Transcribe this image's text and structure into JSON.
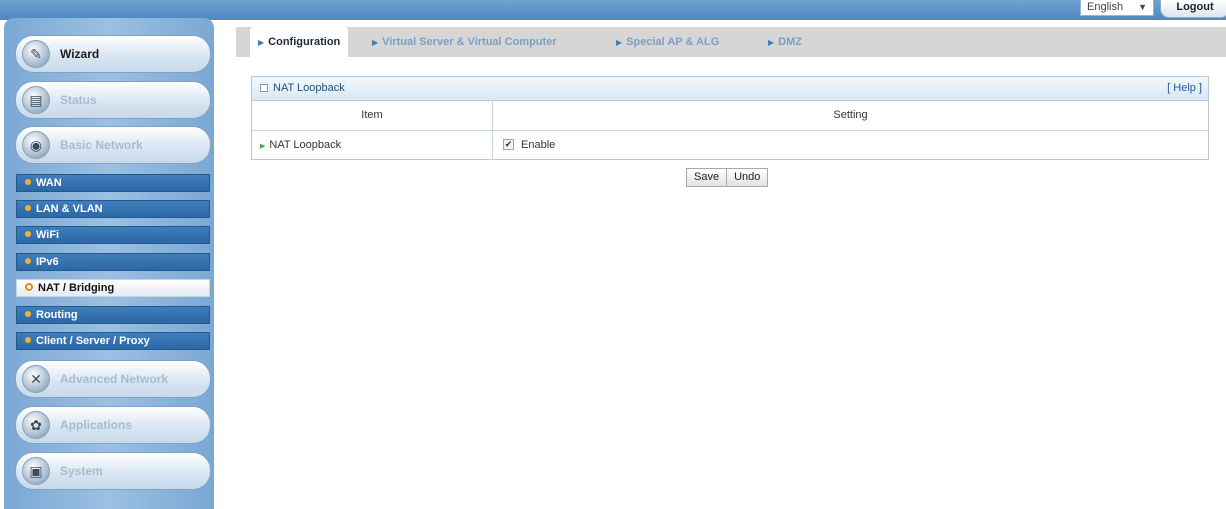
{
  "header": {
    "language": "English",
    "logout_label": "Logout"
  },
  "sidebar": {
    "main_items": [
      {
        "label": "Wizard",
        "icon": "wizard-icon"
      },
      {
        "label": "Status",
        "icon": "status-icon"
      },
      {
        "label": "Basic Network",
        "icon": "globe-icon"
      },
      {
        "label": "Advanced Network",
        "icon": "tools-icon"
      },
      {
        "label": "Applications",
        "icon": "applications-icon"
      },
      {
        "label": "System",
        "icon": "system-icon"
      }
    ],
    "sub_items": [
      {
        "label": "WAN"
      },
      {
        "label": "LAN & VLAN"
      },
      {
        "label": "WiFi"
      },
      {
        "label": "IPv6"
      },
      {
        "label": "NAT / Bridging",
        "active": true
      },
      {
        "label": "Routing"
      },
      {
        "label": "Client / Server / Proxy"
      }
    ]
  },
  "tabs": [
    {
      "label": "Configuration",
      "active": true
    },
    {
      "label": "Virtual Server & Virtual Computer"
    },
    {
      "label": "Special AP & ALG"
    },
    {
      "label": "DMZ"
    }
  ],
  "panel": {
    "title": "NAT Loopback",
    "help": "[ Help ]",
    "col_item": "Item",
    "col_setting": "Setting",
    "row_label": "NAT Loopback",
    "checkbox_label": "Enable",
    "checkbox_checked": true
  },
  "buttons": {
    "save": "Save",
    "undo": "Undo"
  },
  "colors": {
    "accent": "#3f7dbb",
    "active_dot": "#e88a10"
  }
}
